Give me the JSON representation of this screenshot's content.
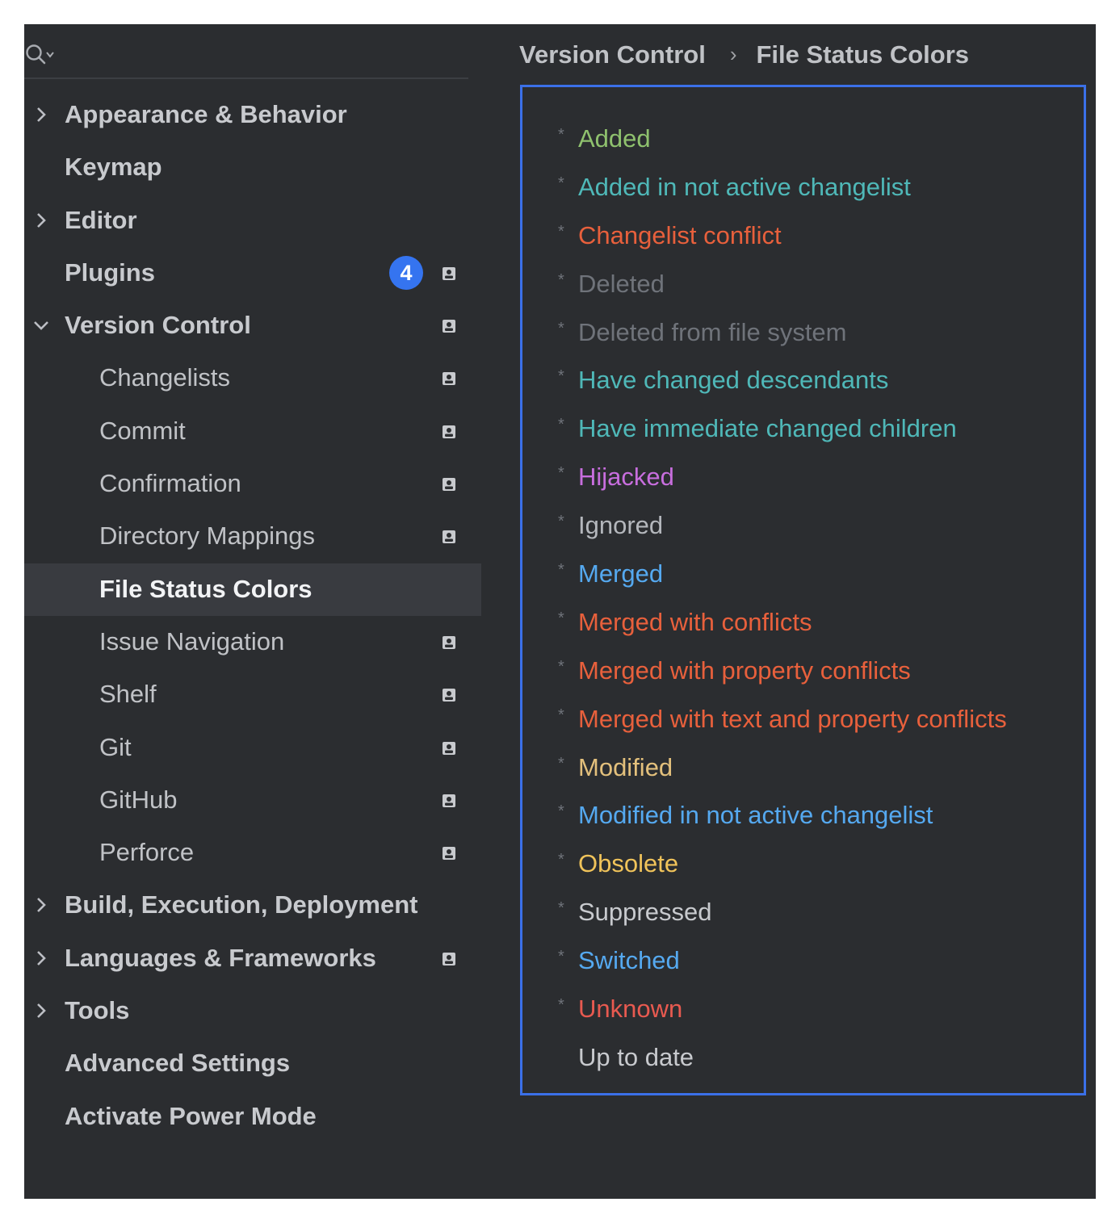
{
  "breadcrumb": {
    "parent": "Version Control",
    "separator": "›",
    "current": "File Status Colors"
  },
  "sidebar": {
    "items": [
      {
        "label": "Appearance & Behavior",
        "level": 0,
        "chevron": "right"
      },
      {
        "label": "Keymap",
        "level": 0
      },
      {
        "label": "Editor",
        "level": 0,
        "chevron": "right"
      },
      {
        "label": "Plugins",
        "level": 0,
        "badge": "4",
        "profile_icon": true
      },
      {
        "label": "Version Control",
        "level": 0,
        "chevron": "down",
        "profile_icon": true
      },
      {
        "label": "Changelists",
        "level": 1,
        "profile_icon": true
      },
      {
        "label": "Commit",
        "level": 1,
        "profile_icon": true
      },
      {
        "label": "Confirmation",
        "level": 1,
        "profile_icon": true
      },
      {
        "label": "Directory Mappings",
        "level": 1,
        "profile_icon": true
      },
      {
        "label": "File Status Colors",
        "level": 1,
        "selected": true
      },
      {
        "label": "Issue Navigation",
        "level": 1,
        "profile_icon": true
      },
      {
        "label": "Shelf",
        "level": 1,
        "profile_icon": true
      },
      {
        "label": "Git",
        "level": 1,
        "profile_icon": true
      },
      {
        "label": "GitHub",
        "level": 1,
        "profile_icon": true
      },
      {
        "label": "Perforce",
        "level": 1,
        "profile_icon": true
      },
      {
        "label": "Build, Execution, Deployment",
        "level": 0,
        "chevron": "right"
      },
      {
        "label": "Languages & Frameworks",
        "level": 0,
        "chevron": "right",
        "profile_icon": true
      },
      {
        "label": "Tools",
        "level": 0,
        "chevron": "right"
      },
      {
        "label": "Advanced Settings",
        "level": 0
      },
      {
        "label": "Activate Power Mode",
        "level": 0
      }
    ]
  },
  "file_statuses": [
    {
      "label": "Added",
      "color": "#8fc16e",
      "modified": true
    },
    {
      "label": "Added in not active changelist",
      "color": "#4fb8b8",
      "modified": true
    },
    {
      "label": "Changelist conflict",
      "color": "#e8603c",
      "modified": true
    },
    {
      "label": "Deleted",
      "color": "#6f737a",
      "modified": true
    },
    {
      "label": "Deleted from file system",
      "color": "#6f737a",
      "modified": true
    },
    {
      "label": "Have changed descendants",
      "color": "#4fb8b8",
      "modified": true
    },
    {
      "label": "Have immediate changed children",
      "color": "#4fb8b8",
      "modified": true
    },
    {
      "label": "Hijacked",
      "color": "#c86ede",
      "modified": true
    },
    {
      "label": "Ignored",
      "color": "#b4b7bc",
      "modified": true
    },
    {
      "label": "Merged",
      "color": "#55a9f0",
      "modified": true
    },
    {
      "label": "Merged with conflicts",
      "color": "#e8603c",
      "modified": true
    },
    {
      "label": "Merged with property conflicts",
      "color": "#e8603c",
      "modified": true
    },
    {
      "label": "Merged with text and property conflicts",
      "color": "#e8603c",
      "modified": true
    },
    {
      "label": "Modified",
      "color": "#e3c07c",
      "modified": true
    },
    {
      "label": "Modified in not active changelist",
      "color": "#55a9f0",
      "modified": true
    },
    {
      "label": "Obsolete",
      "color": "#f0c35a",
      "modified": true
    },
    {
      "label": "Suppressed",
      "color": "#c8cace",
      "modified": true
    },
    {
      "label": "Switched",
      "color": "#55a9f0",
      "modified": true
    },
    {
      "label": "Unknown",
      "color": "#e85a50",
      "modified": true
    },
    {
      "label": "Up to date",
      "color": "#c8cace",
      "modified": false
    }
  ]
}
